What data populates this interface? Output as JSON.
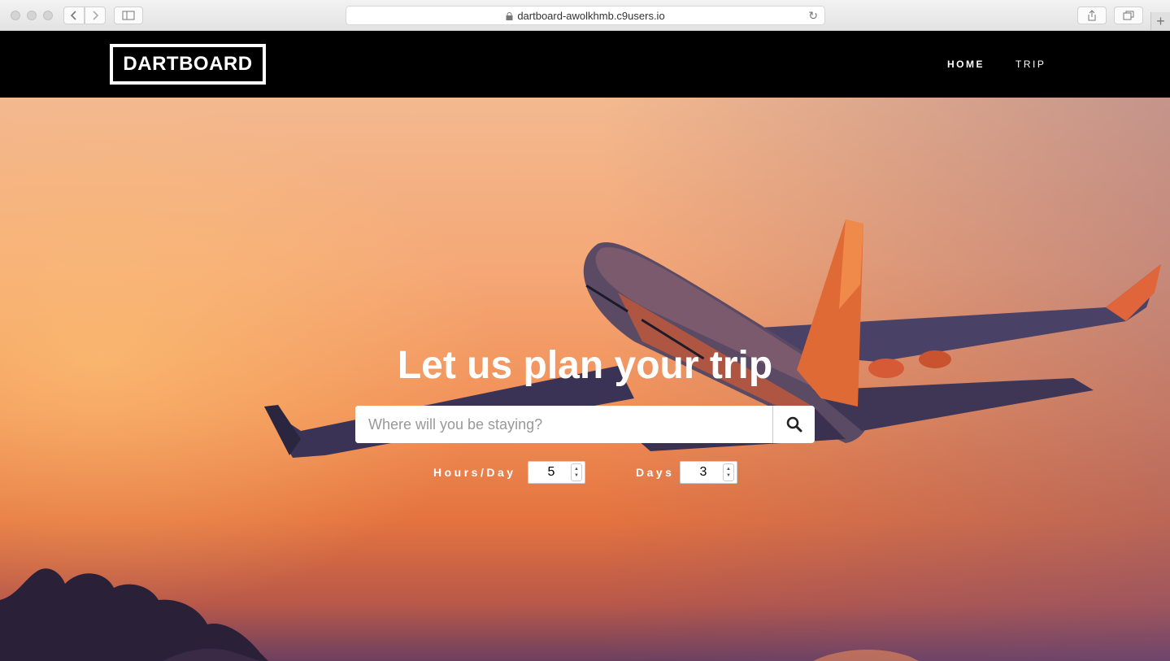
{
  "browser": {
    "url": "dartboard-awolkhmb.c9users.io",
    "back_icon": "chevron-left-icon",
    "forward_icon": "chevron-right-icon",
    "sidebar_icon": "sidebar-icon",
    "share_icon": "share-icon",
    "tabs_icon": "tabs-icon",
    "new_tab_label": "+"
  },
  "header": {
    "logo": "DARTBOARD",
    "nav": {
      "home": "HOME",
      "trip": "TRIP"
    }
  },
  "hero": {
    "headline": "Let us plan your trip",
    "search": {
      "placeholder": "Where will you be staying?",
      "value": "",
      "button_icon": "search-icon"
    },
    "hours_per_day": {
      "label": "Hours/Day",
      "value": "5"
    },
    "days": {
      "label": "Days",
      "value": "3"
    }
  },
  "colors": {
    "header_bg": "#000000",
    "text_light": "#ffffff",
    "sky_top": "#f3b98f",
    "sky_bottom": "#e4733f"
  }
}
